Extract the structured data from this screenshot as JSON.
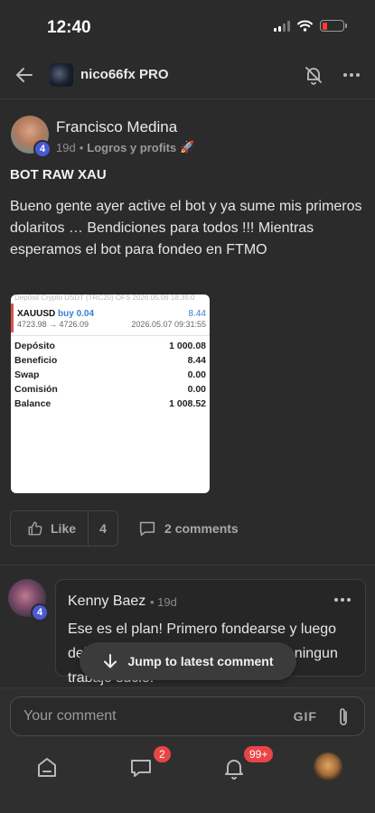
{
  "status": {
    "time": "12:40"
  },
  "header": {
    "title": "nico66fx PRO"
  },
  "post": {
    "author": "Francisco Medina",
    "author_level": "4",
    "age": "19d",
    "separator": "•",
    "category": "Logros y profits",
    "category_emoji": "🚀",
    "title": "BOT RAW XAU",
    "body": "Bueno gente ayer active el bot y ya sume mis primeros dolaritos … Bendiciones para todos !!! Mientras esperamos el bot para fondeo en FTMO",
    "image": {
      "top_strip": "Depósit Crypto USDT (TRC20) OFS  2026.05.06 18:35:0",
      "symbol": "XAUUSD",
      "direction": "buy 0.04",
      "profit": "8.44",
      "prices": "4723.98 → 4726.09",
      "datetime": "2026.05.07 09:31:55",
      "rows": [
        {
          "label": "Depósito",
          "value": "1 000.08"
        },
        {
          "label": "Beneficio",
          "value": "8.44"
        },
        {
          "label": "Swap",
          "value": "0.00"
        },
        {
          "label": "Comisión",
          "value": "0.00"
        },
        {
          "label": "Balance",
          "value": "1 008.52"
        }
      ]
    },
    "like_label": "Like",
    "like_count": "4",
    "comments_label": "2 comments"
  },
  "comment": {
    "author": "Kenny Baez",
    "author_level": "4",
    "age": "• 19d",
    "text": "Ese es el plan! Primero fondearse y luego dejarlo trabajar en la real sin hacer ningun trabajo sucio!"
  },
  "jump_label": "Jump to latest comment",
  "composer": {
    "placeholder": "Your comment",
    "gif_label": "GIF"
  },
  "nav": {
    "chat_badge": "2",
    "notifications_badge": "99+"
  },
  "colors": {
    "background": "#2b2b2b",
    "badge": "#e84545",
    "level_badge": "#4a5ad6",
    "link_blue": "#3a7bd5"
  }
}
